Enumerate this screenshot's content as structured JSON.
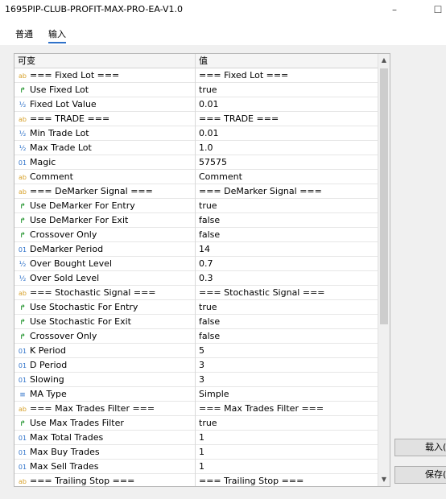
{
  "window": {
    "title": "1695PIP-CLUB-PROFIT-MAX-PRO-EA-V1.0",
    "minimize_symbol": "–"
  },
  "tabs": [
    {
      "label": "普通",
      "active": false
    },
    {
      "label": "输入",
      "active": true
    }
  ],
  "table": {
    "headers": [
      "可变",
      "值"
    ],
    "rows": [
      {
        "type": "string",
        "icon": "ab",
        "name": "=== Fixed Lot ===",
        "value": "=== Fixed Lot ==="
      },
      {
        "type": "bool",
        "icon": "↱",
        "name": "Use Fixed Lot",
        "value": "true"
      },
      {
        "type": "double",
        "icon": "½",
        "name": "Fixed Lot Value",
        "value": "0.01"
      },
      {
        "type": "string",
        "icon": "ab",
        "name": "=== TRADE ===",
        "value": "=== TRADE ==="
      },
      {
        "type": "double",
        "icon": "½",
        "name": "Min Trade Lot",
        "value": "0.01"
      },
      {
        "type": "double",
        "icon": "½",
        "name": "Max Trade Lot",
        "value": "1.0"
      },
      {
        "type": "int",
        "icon": "01",
        "name": "Magic",
        "value": "57575"
      },
      {
        "type": "string",
        "icon": "ab",
        "name": "Comment",
        "value": "Comment"
      },
      {
        "type": "string",
        "icon": "ab",
        "name": "=== DeMarker Signal ===",
        "value": "=== DeMarker Signal ==="
      },
      {
        "type": "bool",
        "icon": "↱",
        "name": "Use DeMarker For Entry",
        "value": "true"
      },
      {
        "type": "bool",
        "icon": "↱",
        "name": "Use DeMarker For Exit",
        "value": "false"
      },
      {
        "type": "bool",
        "icon": "↱",
        "name": "Crossover Only",
        "value": "false"
      },
      {
        "type": "int",
        "icon": "01",
        "name": "DeMarker Period",
        "value": "14"
      },
      {
        "type": "double",
        "icon": "½",
        "name": "Over Bought Level",
        "value": "0.7"
      },
      {
        "type": "double",
        "icon": "½",
        "name": "Over Sold Level",
        "value": "0.3"
      },
      {
        "type": "string",
        "icon": "ab",
        "name": "=== Stochastic Signal ===",
        "value": "=== Stochastic Signal ==="
      },
      {
        "type": "bool",
        "icon": "↱",
        "name": "Use Stochastic For Entry",
        "value": "true"
      },
      {
        "type": "bool",
        "icon": "↱",
        "name": "Use Stochastic For Exit",
        "value": "false"
      },
      {
        "type": "bool",
        "icon": "↱",
        "name": "Crossover Only",
        "value": "false"
      },
      {
        "type": "int",
        "icon": "01",
        "name": "K Period",
        "value": "5"
      },
      {
        "type": "int",
        "icon": "01",
        "name": "D Period",
        "value": "3"
      },
      {
        "type": "int",
        "icon": "01",
        "name": "Slowing",
        "value": "3"
      },
      {
        "type": "enum",
        "icon": "≡",
        "name": "MA Type",
        "value": "Simple"
      },
      {
        "type": "string",
        "icon": "ab",
        "name": "=== Max Trades  Filter ===",
        "value": "=== Max Trades Filter ==="
      },
      {
        "type": "bool",
        "icon": "↱",
        "name": "Use Max Trades Filter",
        "value": "true"
      },
      {
        "type": "int",
        "icon": "01",
        "name": "Max Total Trades",
        "value": "1"
      },
      {
        "type": "int",
        "icon": "01",
        "name": "Max Buy Trades",
        "value": "1"
      },
      {
        "type": "int",
        "icon": "01",
        "name": "Max Sell Trades",
        "value": "1"
      },
      {
        "type": "string",
        "icon": "ab",
        "name": "=== Trailing Stop ===",
        "value": "=== Trailing Stop ==="
      }
    ]
  },
  "buttons": {
    "load": "载入(L)",
    "save": "保存(S)"
  },
  "scrollbar": {
    "up": "▲",
    "down": "▼"
  }
}
